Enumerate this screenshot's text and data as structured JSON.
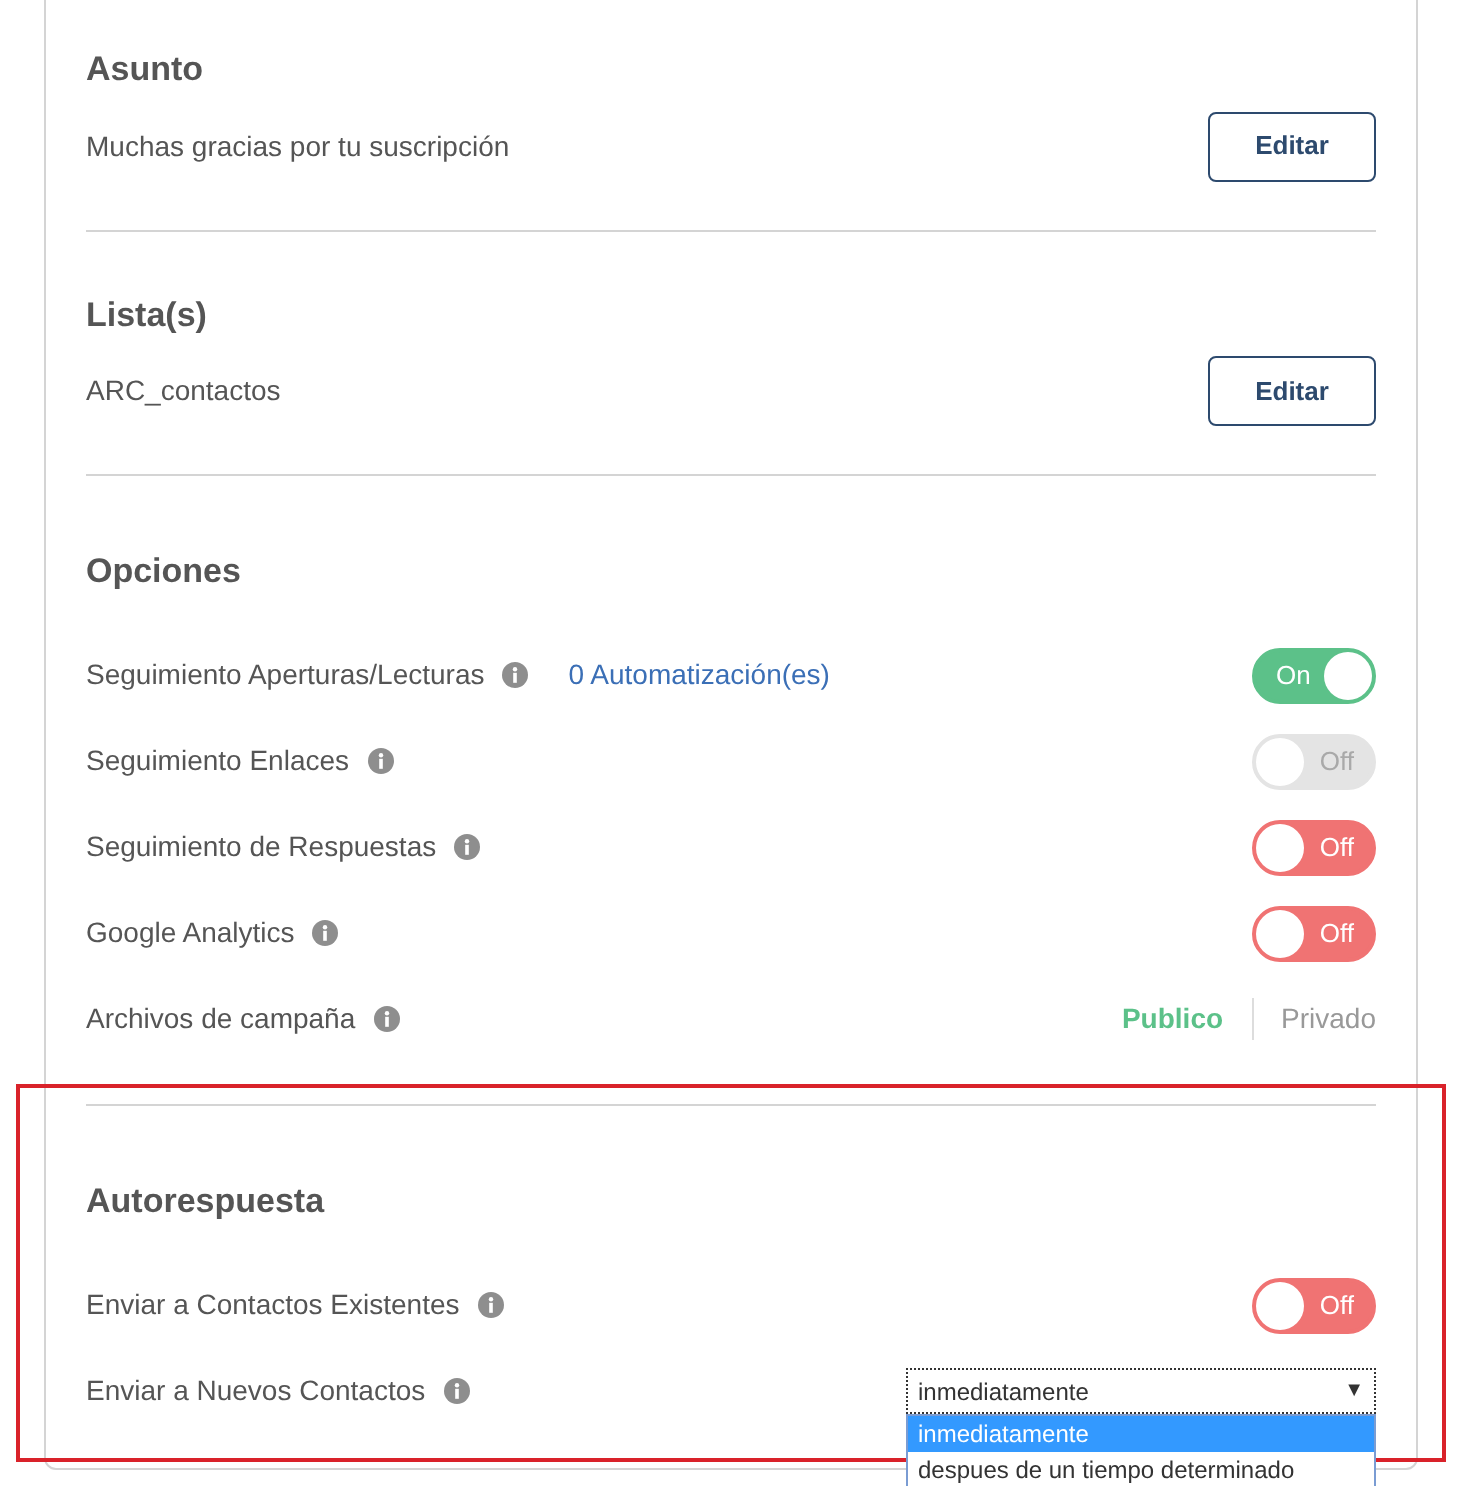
{
  "sections": [
    {
      "title": "Asunto",
      "value": "Muchas gracias por tu suscripción",
      "button": "Editar"
    },
    {
      "title": "Lista(s)",
      "value": "ARC_contactos",
      "button": "Editar"
    }
  ],
  "options": {
    "title": "Opciones",
    "rows": [
      {
        "kind": "toggle",
        "label": "Seguimiento Aperturas/Lecturas",
        "link": "0 Automatización(es)",
        "on": true,
        "disabled": false,
        "state_label": "On"
      },
      {
        "kind": "toggle",
        "label": "Seguimiento Enlaces",
        "on": false,
        "disabled": true,
        "state_label": "Off"
      },
      {
        "kind": "toggle",
        "label": "Seguimiento de Respuestas",
        "on": false,
        "disabled": false,
        "state_label": "Off"
      },
      {
        "kind": "toggle",
        "label": "Google Analytics",
        "on": false,
        "disabled": false,
        "state_label": "Off"
      },
      {
        "kind": "segmented",
        "label": "Archivos de campaña",
        "segments": [
          {
            "label": "Publico",
            "selected": true
          },
          {
            "label": "Privado",
            "selected": false
          }
        ]
      }
    ]
  },
  "autorespuesta": {
    "title": "Autorespuesta",
    "highlighted": true,
    "rows": [
      {
        "kind": "toggle",
        "label": "Enviar a Contactos Existentes",
        "on": false,
        "disabled": false,
        "state_label": "Off"
      },
      {
        "kind": "select",
        "label": "Enviar a Nuevos Contactos",
        "value": "inmediatamente",
        "caret": "▼",
        "expanded": true,
        "options": [
          {
            "label": "inmediatamente",
            "selected": true
          },
          {
            "label": "despues de un tiempo determinado",
            "selected": false
          }
        ]
      }
    ]
  }
}
